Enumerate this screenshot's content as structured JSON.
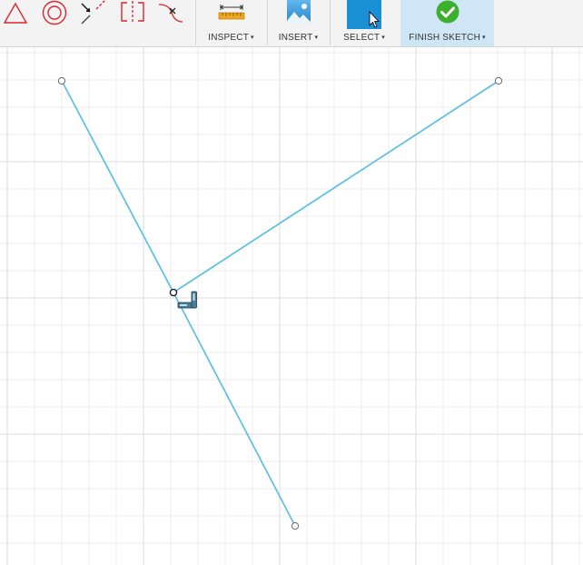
{
  "toolbar": {
    "tools": [
      {
        "name": "polygon-icon",
        "tooltip": "Polygon"
      },
      {
        "name": "circle-icon",
        "tooltip": "Circle"
      },
      {
        "name": "trim-icon",
        "tooltip": "Trim"
      },
      {
        "name": "mirror-icon",
        "tooltip": "Mirror"
      },
      {
        "name": "break-icon",
        "tooltip": "Break"
      }
    ],
    "groups": {
      "inspect": {
        "label": "INSPECT",
        "icon": "ruler-icon"
      },
      "insert": {
        "label": "INSERT",
        "icon": "image-icon"
      },
      "select": {
        "label": "SELECT",
        "icon": "select-cursor-icon"
      },
      "finish": {
        "label": "FINISH SKETCH",
        "icon": "checkmark-icon"
      }
    },
    "caret": "▾"
  },
  "colors": {
    "toolbar_bg": "#f3f3f3",
    "sketch_red": "#d9262e",
    "sketch_line": "#5bbfe3",
    "grid_minor": "#ececec",
    "grid_major": "#dcdcdc",
    "accent_blue": "#1a8fd6",
    "finish_green": "#3cb02e",
    "active_bg": "#cfe6f7"
  },
  "canvas": {
    "cursor": "perpendicular-constraint-cursor-icon"
  }
}
